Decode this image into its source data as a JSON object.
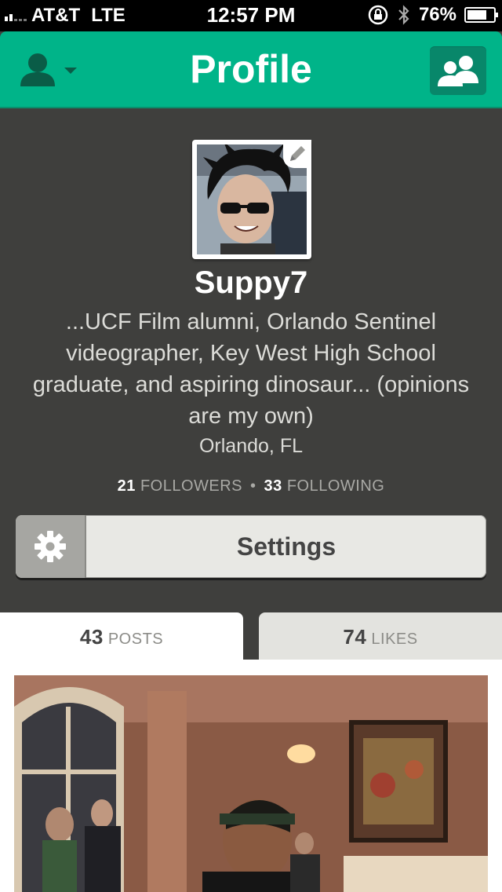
{
  "status_bar": {
    "carrier": "AT&T",
    "network": "LTE",
    "time": "12:57 PM",
    "battery": "76%",
    "battery_level": 0.76
  },
  "navbar": {
    "title": "Profile",
    "left_icon": "account-menu-icon",
    "right_icon": "find-friends-icon"
  },
  "profile": {
    "username": "Suppy7",
    "bio": "...UCF Film alumni, Orlando Sentinel videographer, Key West High School graduate, and aspiring dinosaur... (opinions are my own)",
    "location": "Orlando, FL",
    "followers_count": "21",
    "followers_label": "FOLLOWERS",
    "following_count": "33",
    "following_label": "FOLLOWING",
    "settings_label": "Settings"
  },
  "tabs": {
    "posts_count": "43",
    "posts_label": "POSTS",
    "likes_count": "74",
    "likes_label": "LIKES"
  },
  "colors": {
    "brand": "#00b489",
    "brand_dark": "#08876a",
    "background": "#3f3f3d"
  }
}
